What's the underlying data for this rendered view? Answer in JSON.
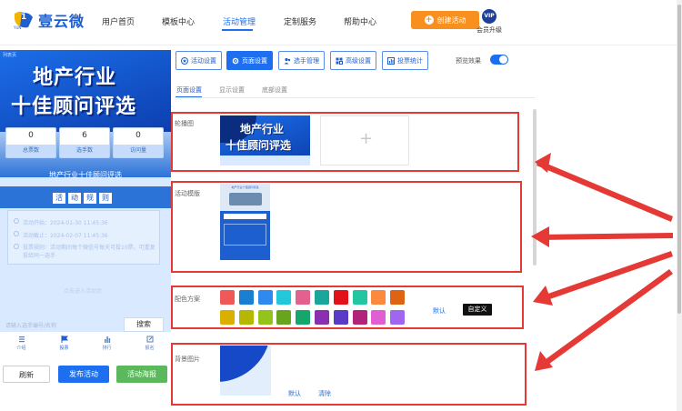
{
  "brand": {
    "name": "壹云微",
    "logo_badge": "1",
    "logo_caption": "YUN"
  },
  "nav": {
    "items": [
      "用户首页",
      "模板中心",
      "活动管理",
      "定制服务",
      "帮助中心"
    ],
    "active_index": 2
  },
  "create_button": "创建活动",
  "vip": {
    "badge": "VIP",
    "label": "会员升级"
  },
  "preview": {
    "banner_tag": "列表页",
    "banner_line1": "地产行业",
    "banner_line2": "十佳顾问评选",
    "stats": [
      {
        "value": "0",
        "label": "总票数"
      },
      {
        "value": "6",
        "label": "选手数"
      },
      {
        "value": "0",
        "label": "访问量"
      }
    ],
    "activity_name": "地产行业十佳顾问评选",
    "rules_chars": [
      "活",
      "动",
      "规",
      "则"
    ],
    "info_rows": [
      "活动开始：2024-01-30 11:45:36",
      "活动截止：2024-02-07 11:45:36",
      "投票规则：活动期间每个微信号每天可投10票，可重复投给同一选手"
    ],
    "white_strip": "点击进入活动页",
    "search_placeholder": "请输入选手编号/名称",
    "search_button": "搜索",
    "bottom_nav": [
      "介绍",
      "投票",
      "排行",
      "报名"
    ],
    "bottom_active": 1
  },
  "left_buttons": {
    "refresh": "刷新",
    "publish": "发布活动",
    "poster": "活动海报"
  },
  "toolbar": {
    "buttons": [
      "活动设置",
      "页面设置",
      "选手管理",
      "高级设置",
      "投票统计"
    ],
    "active_index": 1,
    "preview_label": "预览效果"
  },
  "subtabs": {
    "items": [
      "页面设置",
      "显示设置",
      "底部设置"
    ],
    "active_index": 0
  },
  "sections": {
    "carousel": {
      "label": "轮播图",
      "thumb_line1": "地产行业",
      "thumb_line2": "十佳顾问评选",
      "add_symbol": "+"
    },
    "template": {
      "label": "活动模版",
      "thumb_title": "地产行业十佳顾问评选"
    },
    "colors": {
      "label": "配色方案",
      "row1": [
        "#f0595a",
        "#1a7fd1",
        "#2f8af0",
        "#22c7d9",
        "#e3618e",
        "#1aa69a",
        "#e3121a",
        "#23c6a0",
        "#fb8a3e",
        "#de6313"
      ],
      "row2": [
        "#d9b000",
        "#b4b800",
        "#93c41a",
        "#67a51e",
        "#16a56a",
        "#8a2fb0",
        "#5a3bc6",
        "#b0247a",
        "#e05fd2",
        "#a166ef"
      ],
      "default_label": "默认",
      "custom_label": "自定义"
    },
    "background": {
      "label": "背景图片",
      "default_label": "默认",
      "clear_label": "清除"
    }
  },
  "colors": {
    "primary": "#1e6ff0",
    "orange": "#f7901e",
    "green": "#5cb85c",
    "red_annotation": "#e53935"
  }
}
